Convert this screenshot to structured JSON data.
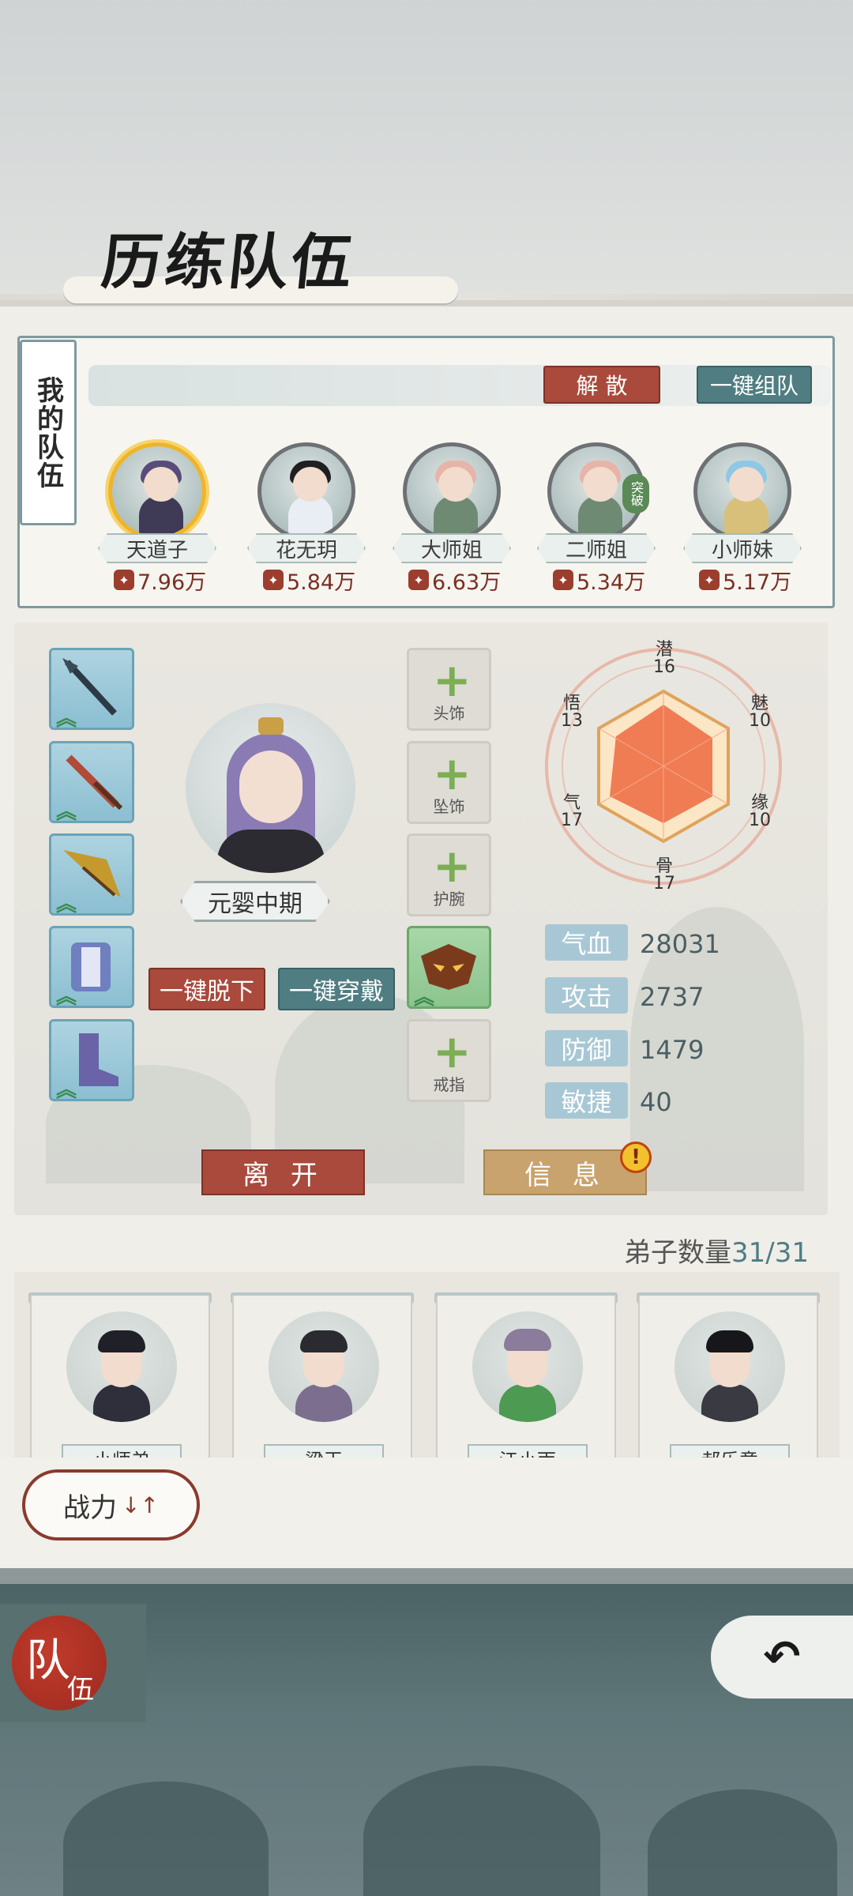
{
  "header": {
    "title": "历练队伍"
  },
  "team": {
    "tag": "我的队伍",
    "disband_label": "解 散",
    "auto_team_label": "一键组队",
    "members": [
      {
        "name": "天道子",
        "power": "7.96万",
        "selected": true
      },
      {
        "name": "花无玥",
        "power": "5.84万"
      },
      {
        "name": "大师姐",
        "power": "6.63万"
      },
      {
        "name": "二师姐",
        "power": "5.34万",
        "badge": "突破"
      },
      {
        "name": "小师妹",
        "power": "5.17万"
      }
    ],
    "power_icon": "power-icon"
  },
  "detail": {
    "realm": "元婴中期",
    "unequip_all_label": "一键脱下",
    "equip_all_label": "一键穿戴",
    "slots": {
      "head": "头饰",
      "pendant": "坠饰",
      "bracer": "护腕",
      "ring": "戒指"
    },
    "radar": {
      "qian": "潜",
      "qian_val": "16",
      "mei": "魅",
      "mei_val": "10",
      "yuan": "缘",
      "yuan_val": "10",
      "gu": "骨",
      "gu_val": "17",
      "qi": "气",
      "qi_val": "17",
      "wu": "悟",
      "wu_val": "13"
    },
    "stats": [
      {
        "label": "气血",
        "value": "28031"
      },
      {
        "label": "攻击",
        "value": "2737"
      },
      {
        "label": "防御",
        "value": "1479"
      },
      {
        "label": "敏捷",
        "value": "40"
      }
    ],
    "leave_label": "离 开",
    "info_label": "信 息",
    "alert": "!"
  },
  "disciples": {
    "count_label": "弟子数量",
    "count": "31/31",
    "list": [
      {
        "name": "小师弟"
      },
      {
        "name": "梁玉"
      },
      {
        "name": "江小雨"
      },
      {
        "name": "郝乐意"
      }
    ]
  },
  "sort": {
    "label": "战力",
    "arrows": "↓↑"
  },
  "nav": {
    "team_big": "队",
    "team_small": "伍",
    "back_icon": "back-icon"
  },
  "colors": {
    "accent_red": "#a94a3c",
    "accent_teal": "#4f7d82",
    "gold": "#c9a36d"
  }
}
